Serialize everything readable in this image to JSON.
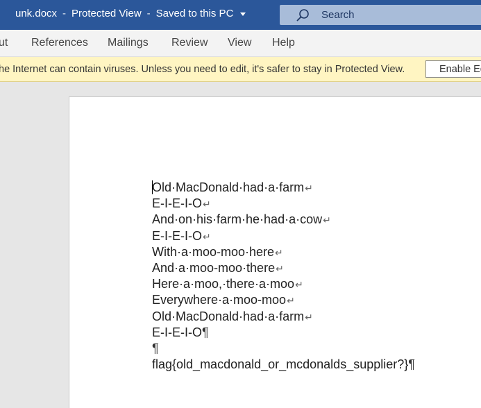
{
  "titlebar": {
    "filename": "unk.docx",
    "sep1": "-",
    "mode": "Protected View",
    "sep2": "-",
    "save_status": "Saved to this PC",
    "search_label": "Search"
  },
  "ribbon": {
    "tabs": [
      "ut",
      "References",
      "Mailings",
      "Review",
      "View",
      "Help"
    ]
  },
  "message_bar": {
    "text": "he Internet can contain viruses. Unless you need to edit, it's safer to stay in Protected View.",
    "button": "Enable Ed"
  },
  "document": {
    "lines": [
      {
        "text": "Old·MacDonald·had·a·farm",
        "mark": "↵"
      },
      {
        "text": "E-I-E-I-O",
        "mark": "↵"
      },
      {
        "text": "And·on·his·farm·he·had·a·cow",
        "mark": "↵"
      },
      {
        "text": "E-I-E-I-O",
        "mark": "↵"
      },
      {
        "text": "With·a·moo-moo·here",
        "mark": "↵"
      },
      {
        "text": "And·a·moo-moo·there",
        "mark": "↵"
      },
      {
        "text": "Here·a·moo,·there·a·moo",
        "mark": "↵"
      },
      {
        "text": "Everywhere·a·moo-moo",
        "mark": "↵"
      },
      {
        "text": "Old·MacDonald·had·a·farm",
        "mark": "↵"
      },
      {
        "text": "E-I-E-I-O",
        "mark": "¶"
      },
      {
        "text": "",
        "mark": "¶"
      },
      {
        "text": "flag{old_macdonald_or_mcdonalds_supplier?}",
        "mark": "¶"
      }
    ]
  },
  "colors": {
    "titlebar": "#2b579a",
    "message_bar": "#fff5c2"
  }
}
